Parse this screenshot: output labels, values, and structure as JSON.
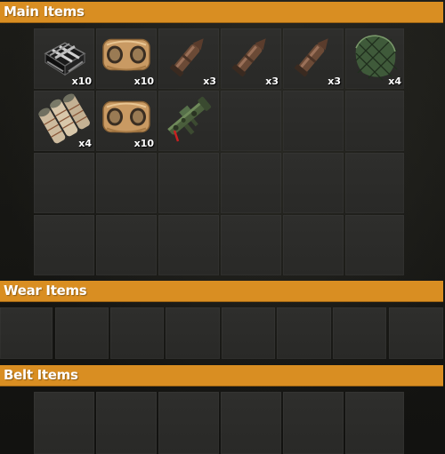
{
  "sections": {
    "main": {
      "title": "Main Items"
    },
    "wear": {
      "title": "Wear Items"
    },
    "belt": {
      "title": "Belt Items"
    }
  },
  "main_slots": [
    {
      "icon": "metal-fragments-icon",
      "qty": "x10"
    },
    {
      "icon": "cloth-bundle-icon",
      "qty": "x10"
    },
    {
      "icon": "rocket-icon",
      "qty": "x3"
    },
    {
      "icon": "rocket-icon",
      "qty": "x3"
    },
    {
      "icon": "rocket-icon",
      "qty": "x3"
    },
    {
      "icon": "green-netting-icon",
      "qty": "x4"
    },
    {
      "icon": "ammo-canisters-icon",
      "qty": "x4"
    },
    {
      "icon": "cloth-bundle-icon",
      "qty": "x10"
    },
    {
      "icon": "rocket-launcher-icon",
      "qty": ""
    }
  ],
  "colors": {
    "header_bg": "#d98e22",
    "header_text": "#ffffff",
    "slot_bg": "#2c2c2a",
    "panel_bg": "#161613"
  }
}
